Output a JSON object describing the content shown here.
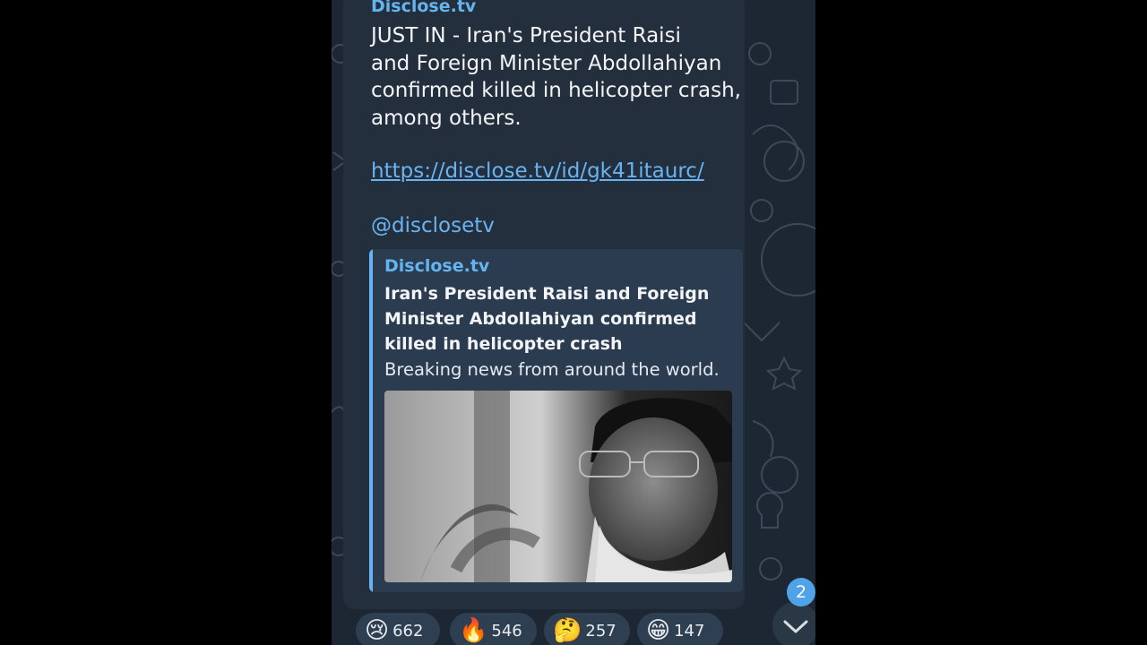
{
  "message": {
    "sender": "Disclose.tv",
    "text": "JUST IN - Iran's President Raisi\nand Foreign Minister Abdollahiyan\nconfirmed killed in helicopter crash,\namong others.",
    "link": "https://disclose.tv/id/gk41itaurc/",
    "mention": "@disclosetv"
  },
  "link_preview": {
    "site_name": "Disclose.tv",
    "title": "Iran's President Raisi and Foreign Minister Abdollahiyan confirmed killed in helicopter crash",
    "description": "Breaking news from around the world."
  },
  "reactions": [
    {
      "icon": "crying-face-icon",
      "emoji": "😢",
      "count": "662"
    },
    {
      "icon": "fire-icon",
      "emoji": "🔥",
      "count": "546"
    },
    {
      "icon": "thinking-face-icon",
      "emoji": "🤔",
      "count": "257"
    },
    {
      "icon": "grinning-face-icon",
      "emoji": "😁",
      "count": "147"
    }
  ],
  "unread_badge": "2",
  "colors": {
    "background": "#1c2733",
    "bubble": "#232f3d",
    "accent": "#6ab3f3",
    "preview": "#2b3c50"
  }
}
